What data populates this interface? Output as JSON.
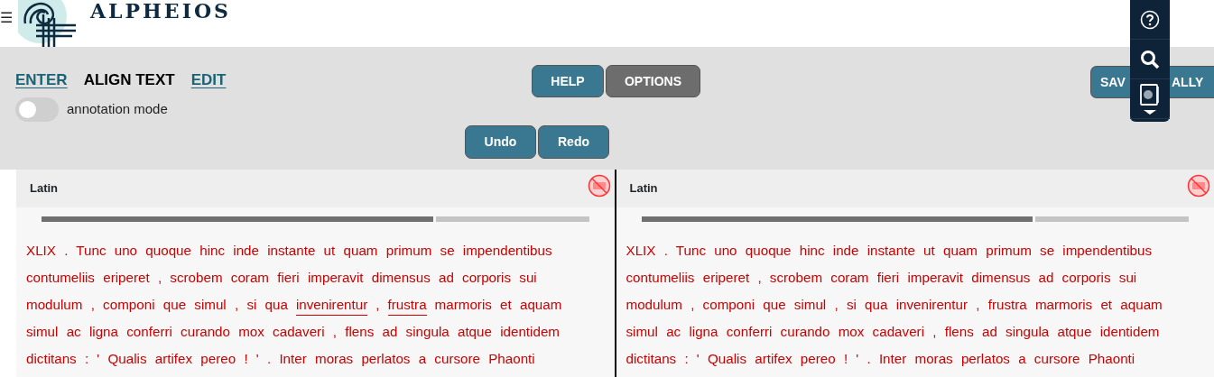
{
  "header": {
    "menu_glyph": "☰",
    "logo_text": "ALPHEIOS"
  },
  "tabs": [
    {
      "label": "ENTER",
      "selected": false
    },
    {
      "label": "ALIGN TEXT",
      "selected": true
    },
    {
      "label": "EDIT",
      "selected": false
    }
  ],
  "annotation_mode": {
    "label": "annotation mode",
    "on": false
  },
  "buttons": [
    {
      "label": "HELP",
      "kind": "primary"
    },
    {
      "label": "OPTIONS",
      "kind": "secondary"
    }
  ],
  "save_button": {
    "visible_parts": [
      "SAV",
      "ALLY"
    ]
  },
  "history_buttons": [
    "Undo",
    "Redo"
  ],
  "side_toolbar": {
    "items": [
      {
        "kind": "help"
      },
      {
        "kind": "search"
      },
      {
        "kind": "book"
      }
    ]
  },
  "panels": [
    {
      "language": "Latin",
      "level": 0.72,
      "lines": [
        [
          {
            "text": "XLIX . Tunc uno quoque hinc inde instante ut quam primum se impendentibus",
            "underlined": false
          }
        ],
        [
          {
            "text": "contumeliis eriperet , scrobem coram fieri imperavit dimensus ad corporis sui",
            "underlined": false
          }
        ],
        [
          {
            "text": "modulum , componi que simul , si qua",
            "underlined": false
          },
          {
            "text": "invenirentur",
            "underlined": true
          },
          {
            "text": ",",
            "underlined": false
          },
          {
            "text": "frustra",
            "underlined": true
          },
          {
            "text": "marmoris et aquam",
            "underlined": false
          }
        ],
        [
          {
            "text": "simul ac ligna conferri curando mox cadaveri , flens ad singula atque identidem",
            "underlined": false
          }
        ],
        [
          {
            "text": "dictitans : ' Qualis artifex pereo ! ' . Inter moras perlatos a cursore Phaonti",
            "underlined": false
          }
        ]
      ]
    },
    {
      "language": "Latin",
      "level": 0.72,
      "lines": [
        [
          {
            "text": "XLIX . Tunc uno quoque hinc inde instante ut quam primum se impendentibus",
            "underlined": false
          }
        ],
        [
          {
            "text": "contumeliis eriperet , scrobem coram fieri imperavit dimensus ad corporis sui",
            "underlined": false
          }
        ],
        [
          {
            "text": "modulum , componi que simul , si qua invenirentur , frustra marmoris et aquam",
            "underlined": false
          }
        ],
        [
          {
            "text": "simul ac ligna conferri curando mox cadaveri , flens ad singula atque identidem",
            "underlined": false
          }
        ],
        [
          {
            "text": "dictitans : ' Qualis artifex pereo ! ' . Inter moras perlatos a cursore Phaonti",
            "underlined": false
          }
        ]
      ]
    }
  ]
}
